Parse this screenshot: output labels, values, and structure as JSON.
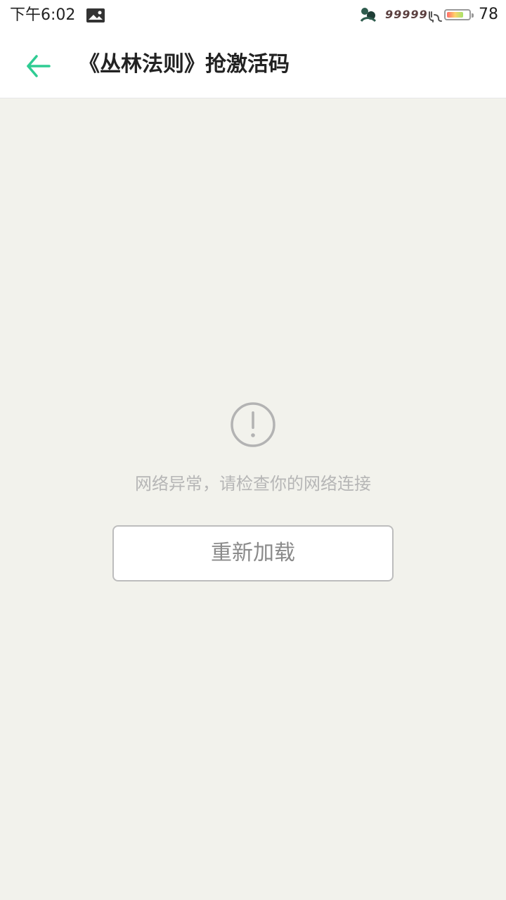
{
  "status_bar": {
    "time": "下午6:02",
    "signal_text": "99999",
    "battery_level": 78,
    "battery_text": "78",
    "icons": {
      "left": "image-icon",
      "app": "app-notification-icon",
      "charging": "charging-plug-icon",
      "battery": "battery-icon"
    }
  },
  "toolbar": {
    "back_icon": "back-arrow-icon",
    "title": "《丛林法则》抢激活码",
    "accent_color": "#2fcc93"
  },
  "content": {
    "error_icon": "exclamation-circle-icon",
    "error_message": "网络异常，请检查你的网络连接",
    "reload_label": "重新加载"
  }
}
